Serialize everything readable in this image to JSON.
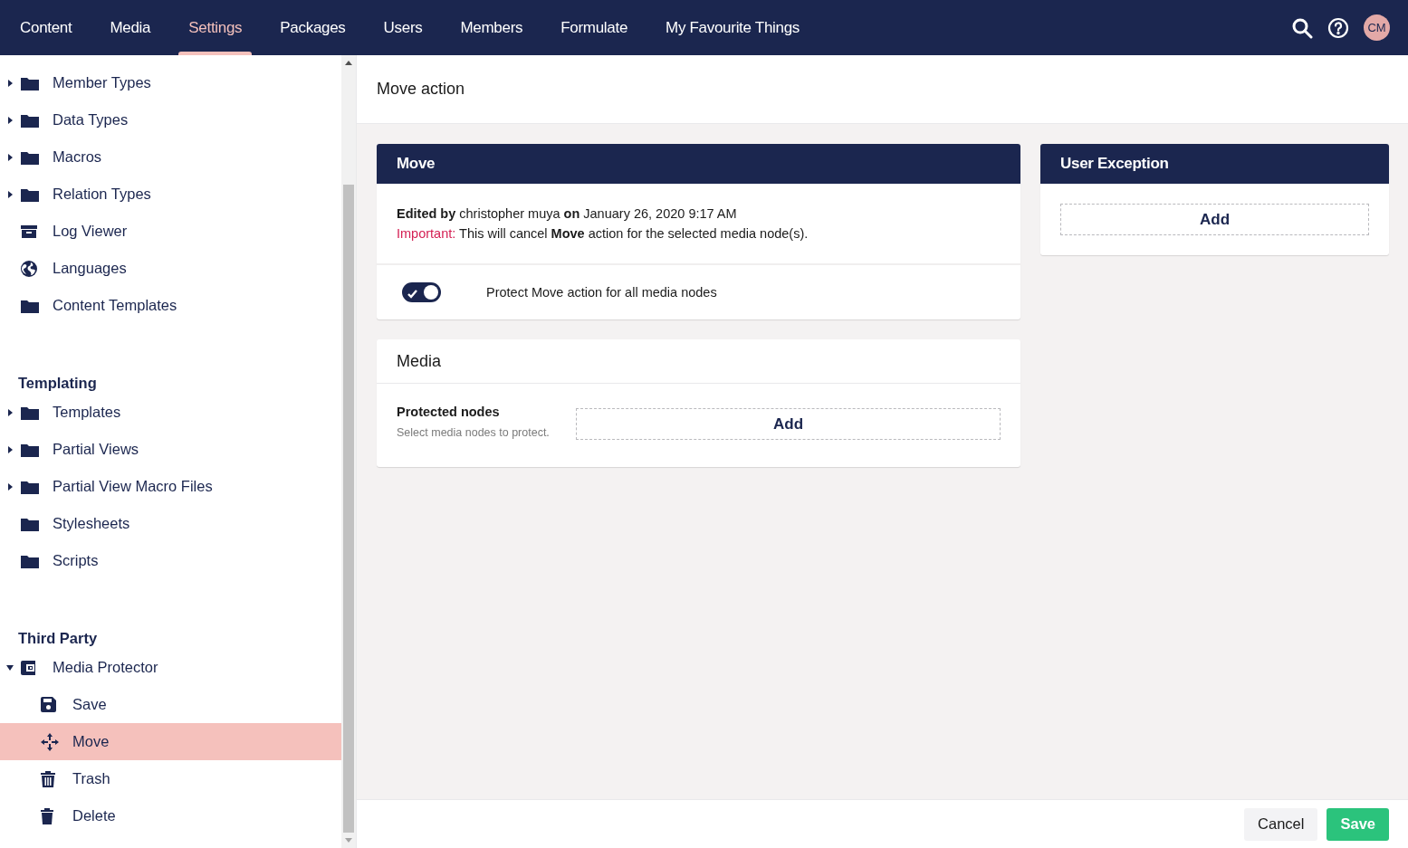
{
  "nav": {
    "tabs": [
      {
        "label": "Content",
        "selected": false
      },
      {
        "label": "Media",
        "selected": false
      },
      {
        "label": "Settings",
        "selected": true
      },
      {
        "label": "Packages",
        "selected": false
      },
      {
        "label": "Users",
        "selected": false
      },
      {
        "label": "Members",
        "selected": false
      },
      {
        "label": "Formulate",
        "selected": false
      },
      {
        "label": "My Favourite Things",
        "selected": false
      }
    ],
    "avatar": "CM"
  },
  "sidebar": {
    "groups": [
      {
        "items": [
          {
            "label": "Member Types",
            "kind": "folder",
            "expanded": false,
            "selected": false
          },
          {
            "label": "Data Types",
            "kind": "folder",
            "expanded": false,
            "selected": false
          },
          {
            "label": "Macros",
            "kind": "folder",
            "expanded": false,
            "selected": false
          },
          {
            "label": "Relation Types",
            "kind": "folder",
            "expanded": false,
            "selected": false
          },
          {
            "label": "Log Viewer",
            "kind": "archive",
            "selected": false
          },
          {
            "label": "Languages",
            "kind": "globe",
            "selected": false
          },
          {
            "label": "Content Templates",
            "kind": "folder",
            "selected": false
          }
        ]
      },
      {
        "heading": "Templating",
        "items": [
          {
            "label": "Templates",
            "kind": "folder",
            "expanded": false,
            "selected": false
          },
          {
            "label": "Partial Views",
            "kind": "folder",
            "expanded": false,
            "selected": false
          },
          {
            "label": "Partial View Macro Files",
            "kind": "folder",
            "expanded": false,
            "selected": false
          },
          {
            "label": "Stylesheets",
            "kind": "folder",
            "selected": false
          },
          {
            "label": "Scripts",
            "kind": "folder",
            "selected": false
          }
        ]
      },
      {
        "heading": "Third Party",
        "items": [
          {
            "label": "Media Protector",
            "kind": "wallet",
            "expanded": true,
            "selected": false,
            "children": [
              {
                "label": "Save",
                "kind": "disk",
                "selected": false
              },
              {
                "label": "Move",
                "kind": "move",
                "selected": true
              },
              {
                "label": "Trash",
                "kind": "trash",
                "selected": false
              },
              {
                "label": "Delete",
                "kind": "bin",
                "selected": false
              }
            ]
          }
        ]
      }
    ]
  },
  "main": {
    "title": "Move action",
    "move_card": {
      "title": "Move",
      "edited": "**Edited by** christopher muya **on** January 26, 2020 9:17 AM",
      "important_label": "Important:",
      "important_text": "This will cancel **Move** action for the selected media node(s).",
      "toggle": {
        "on": true,
        "label": "Protect Move action for all media nodes"
      }
    },
    "media_card": {
      "title": "Media",
      "field_label": "Protected nodes",
      "field_description": "Select media nodes to protect.",
      "add_button": "Add"
    },
    "user_exception_card": {
      "title": "User Exception",
      "add_button": "Add"
    }
  },
  "footer": {
    "buttons": [
      {
        "label": "Cancel",
        "kind": "secondary"
      },
      {
        "label": "Save",
        "kind": "primary"
      }
    ]
  }
}
